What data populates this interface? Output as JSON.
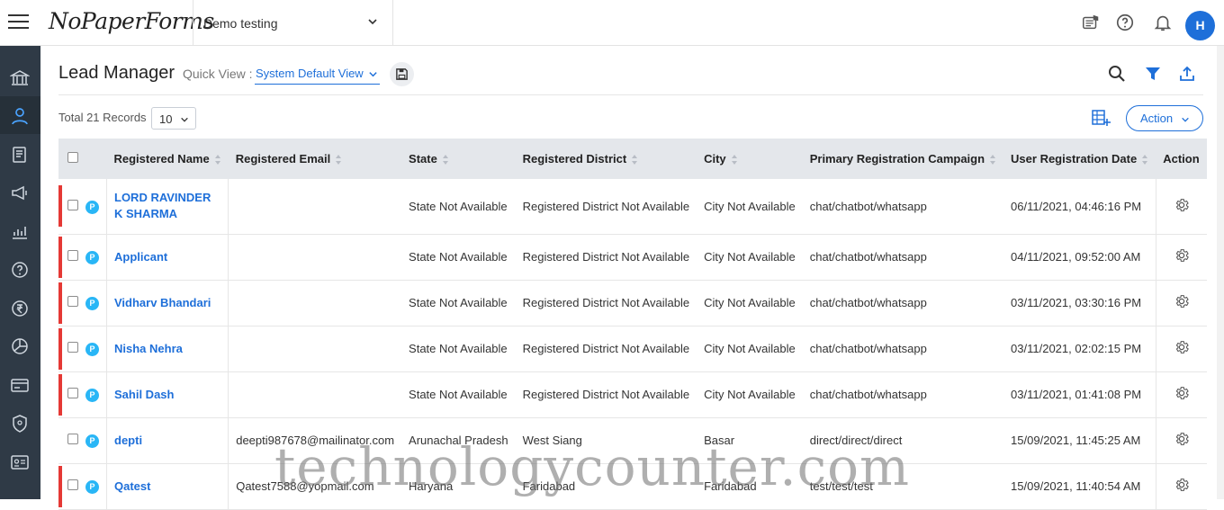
{
  "app": {
    "logo": "NoPaperForms",
    "institute": "Demo testing",
    "avatar_initial": "H",
    "accent_color": "#1e6fd9"
  },
  "sidebar": {
    "items": [
      {
        "icon": "institution-icon"
      },
      {
        "icon": "user-icon",
        "active": true
      },
      {
        "icon": "document-icon"
      },
      {
        "icon": "megaphone-icon"
      },
      {
        "icon": "analytics-icon"
      },
      {
        "icon": "help-icon"
      },
      {
        "icon": "rupee-icon"
      },
      {
        "icon": "pie-chart-icon"
      },
      {
        "icon": "card-icon"
      },
      {
        "icon": "shield-icon"
      },
      {
        "icon": "id-card-icon"
      }
    ]
  },
  "header": {
    "title": "Lead Manager",
    "quick_view_label": "Quick View :",
    "quick_view_value": "System Default View",
    "total_records": "Total 21 Records",
    "per_page": "10",
    "action_label": "Action"
  },
  "table": {
    "columns": [
      "Registered Name",
      "Registered Email",
      "State",
      "Registered District",
      "City",
      "Primary Registration Campaign",
      "User Registration Date",
      "Action"
    ],
    "rows": [
      {
        "flag": true,
        "name": "LORD RAVINDER K SHARMA",
        "email": "",
        "state": "State Not Available",
        "district": "Registered District Not Available",
        "city": "City Not Available",
        "campaign": "chat/chatbot/whatsapp",
        "date": "06/11/2021, 04:46:16 PM"
      },
      {
        "flag": true,
        "name": "Applicant",
        "email": "",
        "state": "State Not Available",
        "district": "Registered District Not Available",
        "city": "City Not Available",
        "campaign": "chat/chatbot/whatsapp",
        "date": "04/11/2021, 09:52:00 AM"
      },
      {
        "flag": true,
        "name": "Vidharv Bhandari",
        "email": "",
        "state": "State Not Available",
        "district": "Registered District Not Available",
        "city": "City Not Available",
        "campaign": "chat/chatbot/whatsapp",
        "date": "03/11/2021, 03:30:16 PM"
      },
      {
        "flag": true,
        "name": "Nisha Nehra",
        "email": "",
        "state": "State Not Available",
        "district": "Registered District Not Available",
        "city": "City Not Available",
        "campaign": "chat/chatbot/whatsapp",
        "date": "03/11/2021, 02:02:15 PM"
      },
      {
        "flag": true,
        "name": "Sahil Dash",
        "email": "",
        "state": "State Not Available",
        "district": "Registered District Not Available",
        "city": "City Not Available",
        "campaign": "chat/chatbot/whatsapp",
        "date": "03/11/2021, 01:41:08 PM"
      },
      {
        "flag": false,
        "name": "depti",
        "email": "deepti987678@mailinator.com",
        "state": "Arunachal Pradesh",
        "district": "West Siang",
        "city": "Basar",
        "campaign": "direct/direct/direct",
        "date": "15/09/2021, 11:45:25 AM"
      },
      {
        "flag": true,
        "name": "Qatest",
        "email": "Qatest7588@yopmail.com",
        "state": "Haryana",
        "district": "Faridabad",
        "city": "Faridabad",
        "campaign": "test/test/test",
        "date": "15/09/2021, 11:40:54 AM"
      }
    ]
  },
  "watermark": "technologycounter.com"
}
